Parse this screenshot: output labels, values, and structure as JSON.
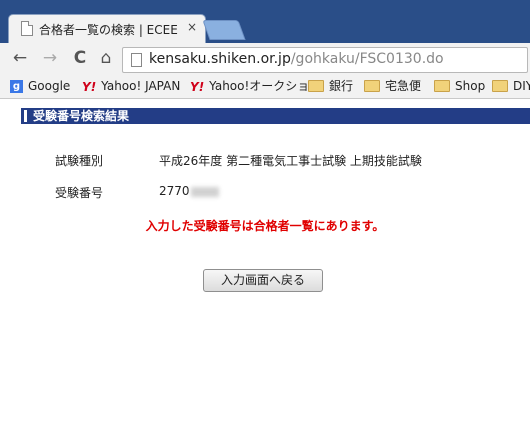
{
  "browser": {
    "tab_title": "合格者一覧の検索 | ECEE",
    "tab_close": "×",
    "url_host": "kensaku.shiken.or.jp",
    "url_path": "/gohkaku/FSC0130.do",
    "nav": {
      "back": "←",
      "forward": "→",
      "reload": "C",
      "home": "⌂"
    }
  },
  "bookmarks": [
    {
      "label": "Google",
      "icon": "google-icon"
    },
    {
      "label": "Yahoo! JAPAN",
      "icon": "yahoo-icon"
    },
    {
      "label": "Yahoo!オークション",
      "icon": "yahoo-icon"
    },
    {
      "label": "銀行",
      "icon": "folder-icon"
    },
    {
      "label": "宅急便",
      "icon": "folder-icon"
    },
    {
      "label": "Shop",
      "icon": "folder-icon"
    },
    {
      "label": "DIY",
      "icon": "folder-icon"
    }
  ],
  "page": {
    "section_title": "受験番号検索結果",
    "exam_type_label": "試験種別",
    "exam_type_value": "平成26年度 第二種電気工事士試験 上期技能試験",
    "exam_number_label": "受験番号",
    "exam_number_value": "2770",
    "result_message": "入力した受験番号は合格者一覧にあります。",
    "back_button": "入力画面へ戻る"
  },
  "colors": {
    "section_bar": "#233d86",
    "result_text": "#e00000",
    "window_frame": "#2a4e88"
  }
}
